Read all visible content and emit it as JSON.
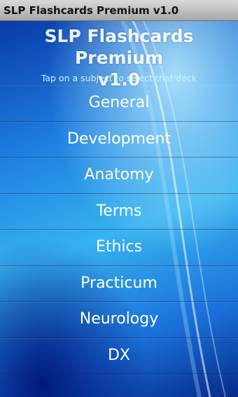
{
  "status_bar": {
    "title": "SLP Flashcards Premium v1.0"
  },
  "header": {
    "title_line1": "SLP Flashcards Premium",
    "title_line2": "v1.0",
    "hint": "Tap on a subject to select that deck"
  },
  "menu": {
    "items": [
      {
        "label": "General"
      },
      {
        "label": "Development"
      },
      {
        "label": "Anatomy"
      },
      {
        "label": "Terms"
      },
      {
        "label": "Ethics"
      },
      {
        "label": "Practicum"
      },
      {
        "label": "Neurology"
      },
      {
        "label": "DX"
      }
    ]
  }
}
